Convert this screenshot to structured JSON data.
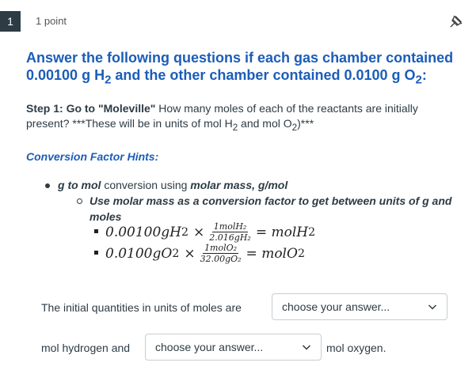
{
  "question": {
    "number": "1",
    "points": "1 point",
    "headline_1": "Answer the following questions if each gas chamber contained",
    "headline_2a": "0.00100 g H",
    "headline_2b": "2",
    "headline_2c": " and the other chamber contained 0.0100 g O",
    "headline_2d": "2",
    "headline_2e": ":"
  },
  "step": {
    "label": "Step 1: Go to \"Moleville\"",
    "text_a": " How many moles of each of the reactants are initially present? ***These will be in units of mol H",
    "sub_a": "2",
    "text_b": " and mol O",
    "sub_b": "2",
    "text_c": ")***"
  },
  "hints": {
    "title": "Conversion Factor Hints:",
    "bullet_bold": "g to mol",
    "bullet_mid": " conversion using ",
    "bullet_bold2": "molar mass, g/mol",
    "sub_bullet": "Use molar mass as a conversion factor to get between units of g and moles"
  },
  "equations": [
    {
      "lhs": "0.00100gH",
      "lhs_sub": "2",
      "num": "1molH₂",
      "den": "2.016gH₂",
      "rhs": "= molH",
      "rhs_sub": "2"
    },
    {
      "lhs": "0.0100gO",
      "lhs_sub": "2",
      "num": "1molO₂",
      "den": "32.00gO₂",
      "rhs": "= molO",
      "rhs_sub": "2"
    }
  ],
  "answer": {
    "line1_text": "The initial quantities in units of moles are",
    "select1_value": "choose your answer...",
    "line2_prefix": "mol hydrogen and",
    "select2_value": "choose your answer...",
    "line2_suffix": "mol oxygen."
  }
}
